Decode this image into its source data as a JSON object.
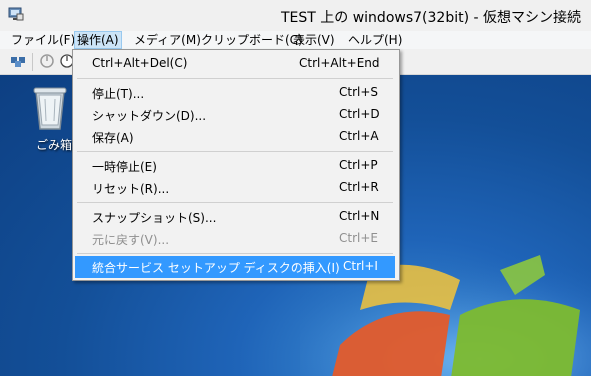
{
  "window": {
    "title": "TEST 上の windows7(32bit)  - 仮想マシン接続"
  },
  "menubar": {
    "items": [
      {
        "label": "ファイル(F)"
      },
      {
        "label": "操作(A)"
      },
      {
        "label": "メディア(M)"
      },
      {
        "label": "クリップボード(C)"
      },
      {
        "label": "表示(V)"
      },
      {
        "label": "ヘルプ(H)"
      }
    ]
  },
  "toolbar": {
    "icons": [
      "ctrl-alt-del-icon",
      "start-icon",
      "power-icon"
    ]
  },
  "desktop": {
    "recycle_bin_label": "ごみ箱"
  },
  "dropdown": {
    "items": [
      {
        "label": "Ctrl+Alt+Del(C)",
        "shortcut": "Ctrl+Alt+End",
        "disabled": false
      },
      {
        "label": "停止(T)...",
        "shortcut": "Ctrl+S",
        "disabled": false
      },
      {
        "label": "シャットダウン(D)...",
        "shortcut": "Ctrl+D",
        "disabled": false
      },
      {
        "label": "保存(A)",
        "shortcut": "Ctrl+A",
        "disabled": false
      },
      {
        "label": "一時停止(E)",
        "shortcut": "Ctrl+P",
        "disabled": false
      },
      {
        "label": "リセット(R)...",
        "shortcut": "Ctrl+R",
        "disabled": false
      },
      {
        "label": "スナップショット(S)...",
        "shortcut": "Ctrl+N",
        "disabled": false
      },
      {
        "label": "元に戻す(V)...",
        "shortcut": "Ctrl+E",
        "disabled": true
      },
      {
        "label": "統合サービス セットアップ ディスクの挿入(I)",
        "shortcut": "Ctrl+I",
        "disabled": false,
        "highlighted": true
      }
    ]
  },
  "colors": {
    "highlight": "#3399ff",
    "desktop_blue": "#1f64b8"
  }
}
